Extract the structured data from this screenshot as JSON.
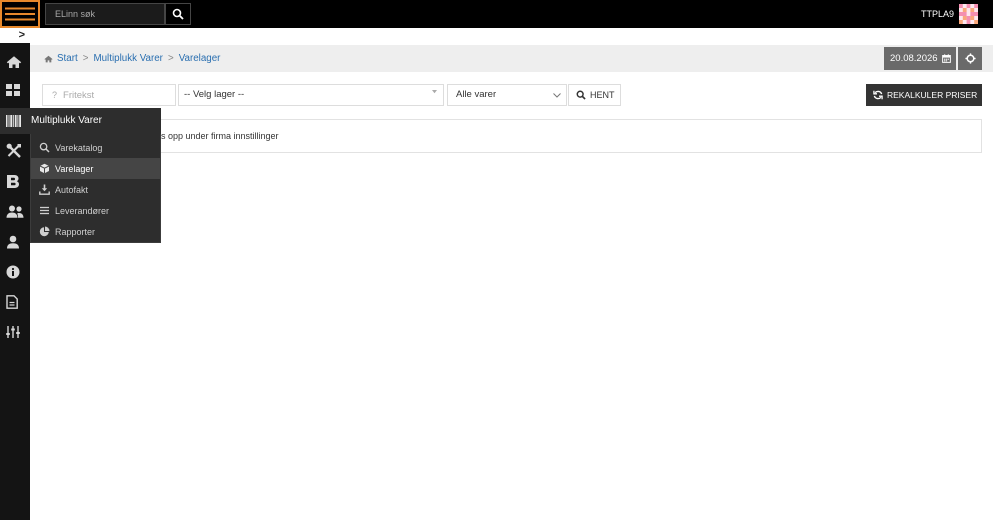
{
  "topbar": {
    "menu_icon": "hamburger-icon",
    "search_placeholder": "ELinn søk",
    "search_icon": "search-icon",
    "user_code": "TTPLA9",
    "avatar_icon": "identicon-avatar"
  },
  "sidebar": {
    "toggle_glyph": ">",
    "items": [
      {
        "icon": "home-icon"
      },
      {
        "icon": "grid-icon"
      },
      {
        "icon": "barcode-icon",
        "active": true
      },
      {
        "icon": "tools-icon"
      },
      {
        "icon": "b-box-icon"
      },
      {
        "icon": "users-icon"
      },
      {
        "icon": "user-icon"
      },
      {
        "icon": "info-circle-icon"
      },
      {
        "icon": "document-icon"
      },
      {
        "icon": "sliders-icon"
      }
    ]
  },
  "flyout": {
    "title": "Multiplukk Varer",
    "items": [
      {
        "label": "Varekatalog",
        "icon": "search-icon"
      },
      {
        "label": "Varelager",
        "icon": "cube-icon",
        "active": true
      },
      {
        "label": "Autofakt",
        "icon": "download-icon"
      },
      {
        "label": "Leverandører",
        "icon": "list-icon"
      },
      {
        "label": "Rapporter",
        "icon": "pie-chart-icon"
      }
    ]
  },
  "breadcrumb": {
    "home_icon": "home-icon",
    "separator": ">",
    "items": [
      "Start",
      "Multiplukk Varer",
      "Varelager"
    ]
  },
  "toolbar": {
    "date": "20.08.2026",
    "date_icon": "calendar-icon",
    "settings_icon": "gear-icon"
  },
  "filters": {
    "fritekst_glyph": "?",
    "fritekst_placeholder": "Fritekst",
    "lager_selected": "-- Velg lager --",
    "varer_selected": "Alle varer",
    "hent_icon": "search-icon",
    "hent_label": "HENT",
    "rekalkuler_icon": "refresh-icon",
    "rekalkuler_label": "REKALKULER PRISER"
  },
  "message": {
    "text": "s opp under firma innstillinger"
  },
  "colors": {
    "accent": "#e8892c",
    "link": "#2a6fb0",
    "topbar": "#000000",
    "sidebar": "#141414",
    "flyout": "#2d2d2d",
    "flyout_active": "#454545",
    "dark_button": "#333333",
    "date_button": "#6a6a6a"
  }
}
